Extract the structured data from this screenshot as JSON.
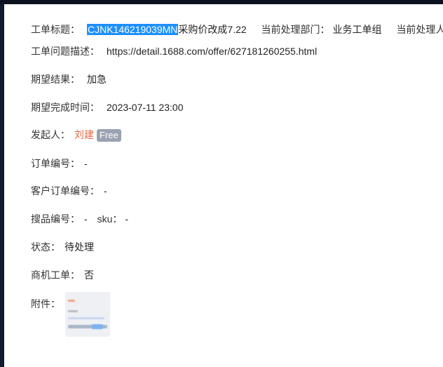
{
  "ticket": {
    "title_label": "工单标题：",
    "title_id": "CJNK146219039MN",
    "title_rest": "采购价改成7.22",
    "dept_label": "当前处理部门：",
    "dept_value": "业务工单组",
    "handler_label": "当前处理人：",
    "desc_label": "工单问题描述：",
    "desc_value": "https://detail.1688.com/offer/627181260255.html",
    "expected_result_label": "期望结果：",
    "expected_result_value": "加急",
    "expected_time_label": "期望完成时间：",
    "expected_time_value": "2023-07-11 23:00",
    "initiator_label": "发起人：",
    "initiator_name": "刘建",
    "initiator_badge": "Free",
    "order_no_label": "订单编号：",
    "order_no_value": "-",
    "customer_order_no_label": "客户订单编号：",
    "customer_order_no_value": "-",
    "product_no_label": "搜品编号：",
    "product_no_value": "-",
    "sku_label": "sku：",
    "sku_value": "-",
    "status_label": "状态：",
    "status_value": "待处理",
    "opportunity_label": "商机工单：",
    "opportunity_value": "否",
    "attachment_label": "附件："
  },
  "colors": {
    "highlight": "#1e90ff",
    "initiator": "#e06a45",
    "badge": "#9aa3b2"
  }
}
